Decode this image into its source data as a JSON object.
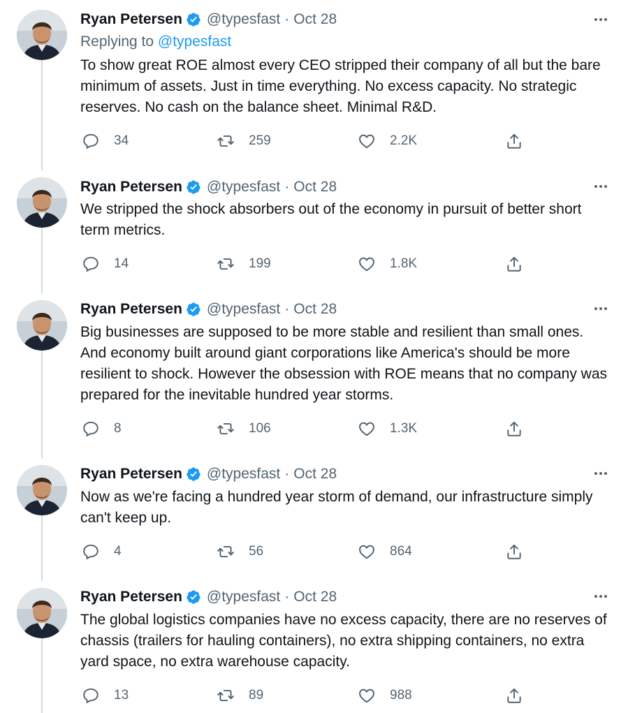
{
  "thread": {
    "replying_prefix": "Replying to",
    "replying_handle": "@typesfast",
    "tweets": [
      {
        "author_name": "Ryan Petersen",
        "handle": "@typesfast",
        "separator": "·",
        "date": "Oct 28",
        "text": "To show great ROE almost every CEO stripped their company of all but the bare minimum of assets. Just in time everything. No excess capacity. No strategic reserves. No cash on the balance sheet. Minimal R&D.",
        "replies": "34",
        "retweets": "259",
        "likes": "2.2K"
      },
      {
        "author_name": "Ryan Petersen",
        "handle": "@typesfast",
        "separator": "·",
        "date": "Oct 28",
        "text": "We stripped the shock absorbers out of the economy in pursuit of better short term metrics.",
        "replies": "14",
        "retweets": "199",
        "likes": "1.8K"
      },
      {
        "author_name": "Ryan Petersen",
        "handle": "@typesfast",
        "separator": "·",
        "date": "Oct 28",
        "text": "Big businesses are supposed to be more stable and resilient than small ones. And economy built around giant corporations like America's should be more resilient to shock. However the obsession with ROE means that no company was prepared for the inevitable hundred year storms.",
        "replies": "8",
        "retweets": "106",
        "likes": "1.3K"
      },
      {
        "author_name": "Ryan Petersen",
        "handle": "@typesfast",
        "separator": "·",
        "date": "Oct 28",
        "text": "Now as we're facing a hundred year storm of demand, our infrastructure simply can't keep up.",
        "replies": "4",
        "retweets": "56",
        "likes": "864"
      },
      {
        "author_name": "Ryan Petersen",
        "handle": "@typesfast",
        "separator": "·",
        "date": "Oct 28",
        "text": "The global logistics companies have no excess capacity, there are no reserves of chassis (trailers for hauling containers), no extra shipping containers, no extra yard space, no extra warehouse capacity.",
        "replies": "13",
        "retweets": "89",
        "likes": "988"
      }
    ]
  },
  "icons": {
    "verified": "verified-badge-icon",
    "more": "more-horizontal-icon",
    "reply": "reply-bubble-icon",
    "retweet": "retweet-arrows-icon",
    "like": "heart-icon",
    "share": "share-upload-icon"
  },
  "colors": {
    "text": "#0f1419",
    "secondary": "#536471",
    "accent": "#1d9bf0",
    "thread_line": "#cfd9de"
  }
}
